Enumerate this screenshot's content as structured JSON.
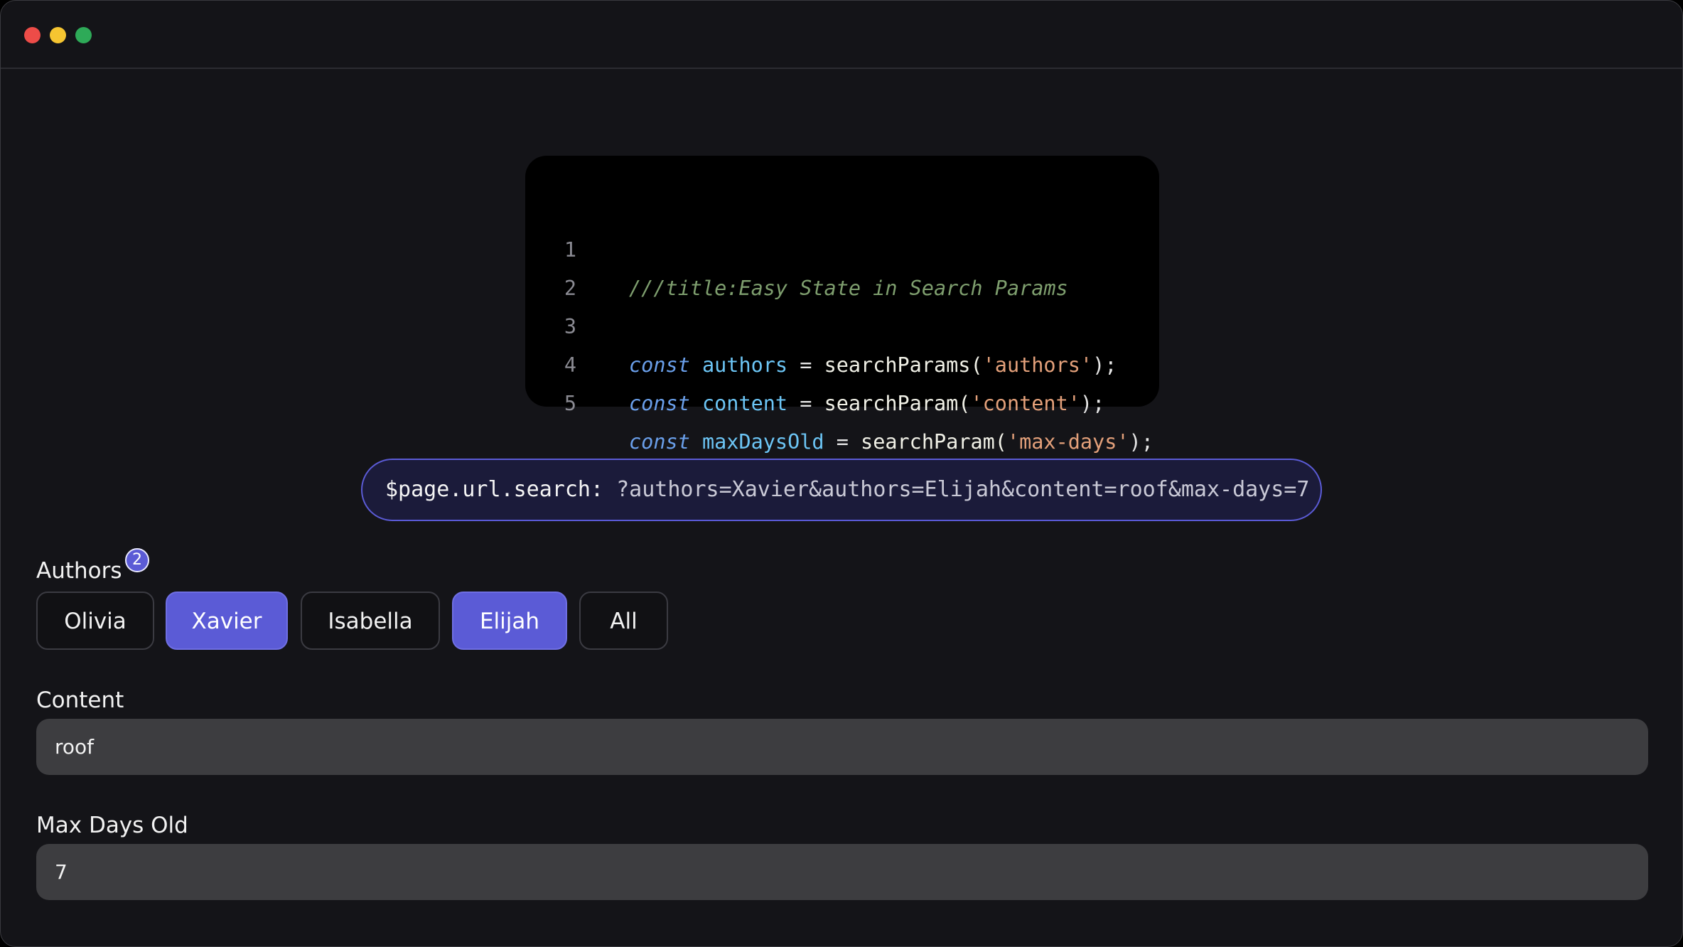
{
  "colors": {
    "red": "#ed4c48",
    "yellow": "#f5c531",
    "green": "#2eaa58",
    "accent": "#5b5bd6"
  },
  "code": {
    "lines": [
      {
        "num": "1",
        "comment": "///title:Easy State in Search Params"
      },
      {
        "num": "2"
      },
      {
        "num": "3",
        "kw": "const",
        "var": "authors",
        "op": " = ",
        "fn": "searchParams(",
        "str": "'authors'",
        "end": ");"
      },
      {
        "num": "4",
        "kw": "const",
        "var": "content",
        "op": " = ",
        "fn": "searchParam(",
        "str": "'content'",
        "end": ");"
      },
      {
        "num": "5",
        "kw": "const",
        "var": "maxDaysOld",
        "op": " = ",
        "fn": "searchParam(",
        "str": "'max-days'",
        "end": ");"
      }
    ]
  },
  "url": {
    "label": "$page.url.search:",
    "value": "?authors=Xavier&authors=Elijah&content=roof&max-days=7"
  },
  "authors": {
    "label": "Authors",
    "selected_count": "2",
    "chips": [
      {
        "label": "Olivia",
        "selected": false
      },
      {
        "label": "Xavier",
        "selected": true
      },
      {
        "label": "Isabella",
        "selected": false
      },
      {
        "label": "Elijah",
        "selected": true
      },
      {
        "label": "All",
        "selected": false
      }
    ]
  },
  "content": {
    "label": "Content",
    "value": "roof"
  },
  "max_days": {
    "label": "Max Days Old",
    "value": "7"
  }
}
